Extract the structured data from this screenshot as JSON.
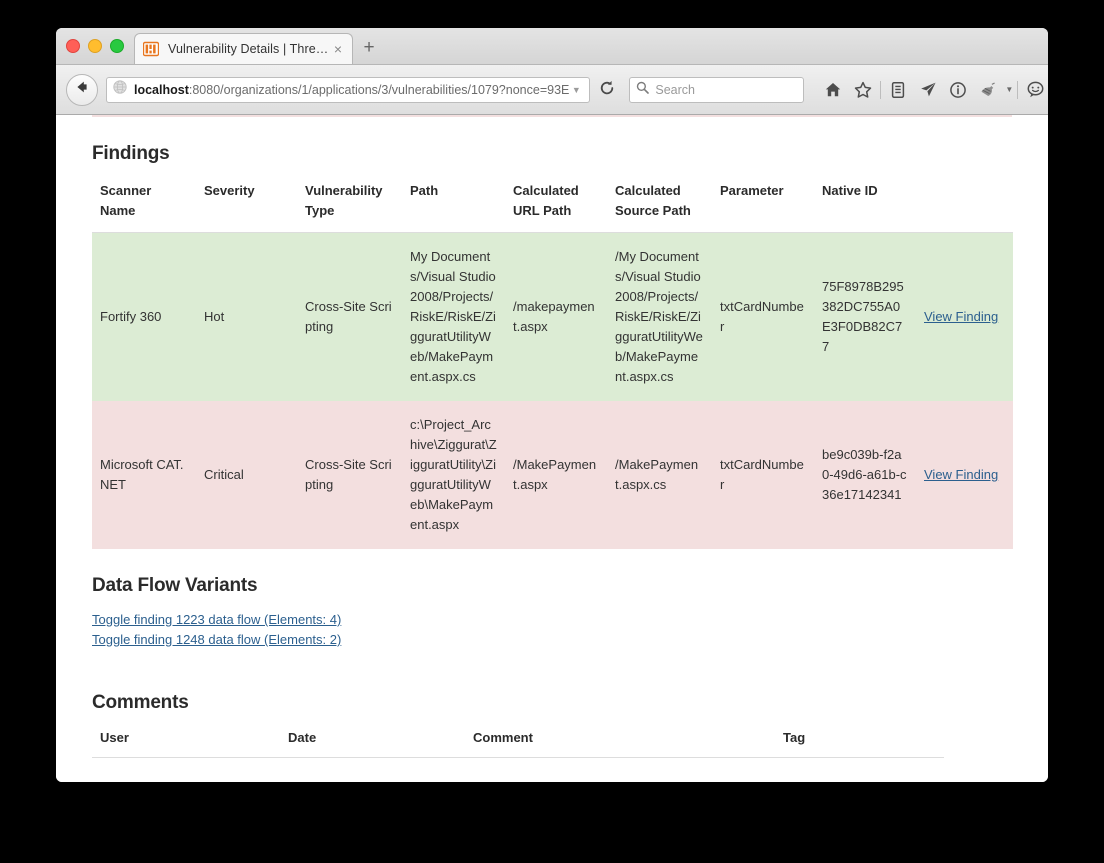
{
  "browser": {
    "tab": {
      "title": "Vulnerability Details | Threa...",
      "favicon_name": "threadfix-logo-icon",
      "close_label": "×"
    },
    "new_tab_label": "+",
    "url": {
      "host": "localhost",
      "rest": ":8080/organizations/1/applications/3/vulnerabilities/1079?nonce=93E",
      "full": "localhost:8080/organizations/1/applications/3/vulnerabilities/1079?nonce=93E"
    },
    "search": {
      "placeholder": "Search"
    },
    "toolbar_icons": [
      "home-icon",
      "bookmark-star-icon",
      "library-icon",
      "send-paper-plane-icon",
      "info-circle-icon",
      "plugin-icon",
      "chevron-down-icon",
      "chat-bubble-icon",
      "hamburger-menu-icon"
    ],
    "window_controls": [
      "close-button",
      "minimize-button",
      "zoom-button"
    ]
  },
  "page": {
    "findings": {
      "title": "Findings",
      "columns": [
        "Scanner Name",
        "Severity",
        "Vulnerability Type",
        "Path",
        "Calculated URL Path",
        "Calculated Source Path",
        "Parameter",
        "Native ID",
        ""
      ],
      "rows": [
        {
          "scanner_name": "Fortify 360",
          "severity": "Hot",
          "vulnerability_type": "Cross-Site Scripting",
          "path": "My Documents/Visual Studio 2008/Projects/RiskE/RiskE/ZigguratUtilityWeb/MakePayment.aspx.cs",
          "calculated_url_path": "/makepayment.aspx",
          "calculated_source_path": "/My Documents/Visual Studio 2008/Projects/RiskE/RiskE/ZigguratUtilityWeb/MakePayment.aspx.cs",
          "parameter": "txtCardNumber",
          "native_id": "75F8978B295382DC755A0E3F0DB82C77",
          "link_label": "View Finding",
          "row_color": "#dcecd4"
        },
        {
          "scanner_name": "Microsoft CAT.NET",
          "severity": "Critical",
          "vulnerability_type": "Cross-Site Scripting",
          "path": "c:\\Project_Archive\\Ziggurat\\ZigguratUtility\\ZigguratUtilityWeb\\MakePayment.aspx",
          "calculated_url_path": "/MakePayment.aspx",
          "calculated_source_path": "/MakePayment.aspx.cs",
          "parameter": "txtCardNumber",
          "native_id": "be9c039b-f2a0-49d6-a61b-c36e17142341",
          "link_label": "View Finding",
          "row_color": "#f3dfdf"
        }
      ]
    },
    "data_flow_variants": {
      "title": "Data Flow Variants",
      "links": [
        "Toggle finding 1223 data flow (Elements: 4)",
        "Toggle finding 1248 data flow (Elements: 2)"
      ]
    },
    "comments": {
      "title": "Comments",
      "columns": [
        "User",
        "Date",
        "Comment",
        "Tag"
      ]
    }
  },
  "colors": {
    "link": "#2b5f8e",
    "row_green": "#dcecd4",
    "row_pink": "#f3dfdf",
    "heading": "#2b2b2b"
  }
}
